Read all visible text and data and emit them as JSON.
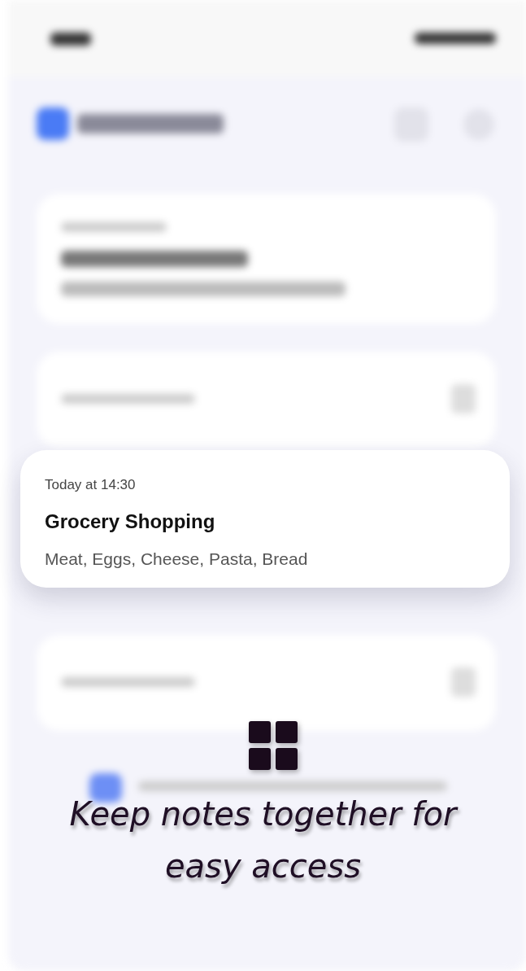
{
  "note_card": {
    "time": "Today at 14:30",
    "title": "Grocery Shopping",
    "body": "Meat, Eggs, Cheese, Pasta, Bread"
  },
  "headline": "Keep notes together for easy access"
}
